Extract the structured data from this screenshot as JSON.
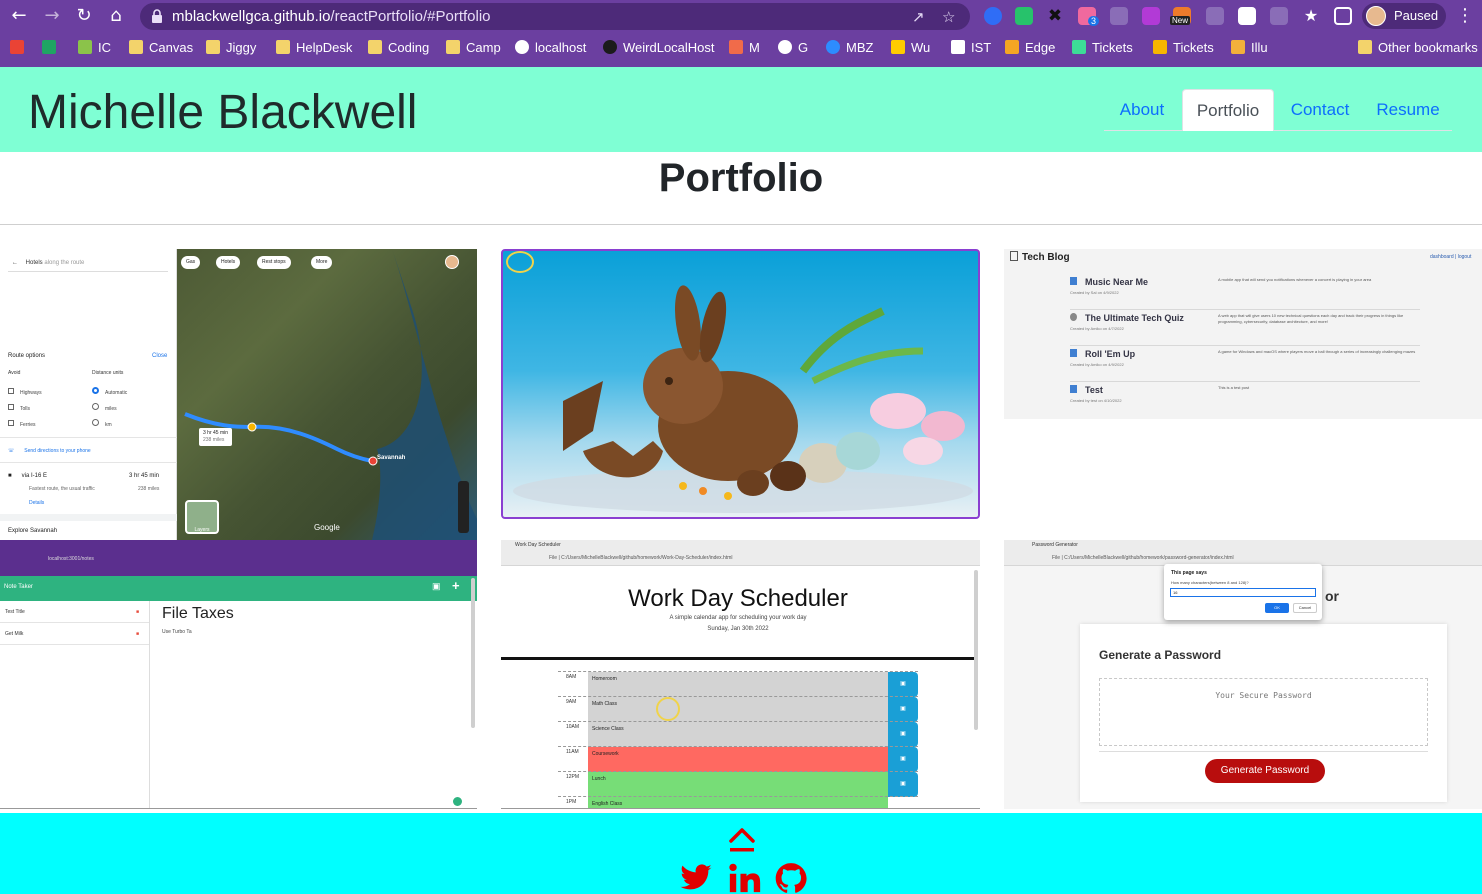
{
  "browser": {
    "url_host": "mblackwellgca.github.io",
    "url_path": "/reactPortfolio/#Portfolio",
    "profile_status": "Paused",
    "extension_badge_count": "3",
    "extension_new_label": "New",
    "bookmarks": [
      {
        "label": "",
        "icon": "gmail-icon"
      },
      {
        "label": "",
        "icon": "drive-icon"
      },
      {
        "label": "IC",
        "icon": "ic-icon"
      },
      {
        "label": "Canvas",
        "icon": "folder-icon"
      },
      {
        "label": "Jiggy",
        "icon": "folder-icon"
      },
      {
        "label": "HelpDesk",
        "icon": "folder-icon"
      },
      {
        "label": "Coding",
        "icon": "folder-icon"
      },
      {
        "label": "Camp",
        "icon": "folder-icon"
      },
      {
        "label": "localhost",
        "icon": "globe-icon"
      },
      {
        "label": "WeirdLocalHost",
        "icon": "react-icon"
      },
      {
        "label": "M",
        "icon": "m-icon"
      },
      {
        "label": "G",
        "icon": "google-icon"
      },
      {
        "label": "MBZ",
        "icon": "zoom-icon"
      },
      {
        "label": "Wu",
        "icon": "wu-icon"
      },
      {
        "label": "IST",
        "icon": "ist-icon"
      },
      {
        "label": "Edge",
        "icon": "edge-icon"
      },
      {
        "label": "Tickets",
        "icon": "tickets-icon"
      },
      {
        "label": "Tickets",
        "icon": "tickets-icon-2"
      },
      {
        "label": "Illu",
        "icon": "illu-icon"
      },
      {
        "label": "Other bookmarks",
        "icon": "folder-icon"
      }
    ]
  },
  "site": {
    "name": "Michelle Blackwell",
    "nav": [
      "About",
      "Portfolio",
      "Contact",
      "Resume"
    ],
    "active_nav": "Portfolio",
    "section_title": "Portfolio"
  },
  "tiles": {
    "maps": {
      "search_text": "Hotels",
      "search_hint": "along the route",
      "chips": [
        "Gas",
        "Hotels",
        "Rest stops",
        "More"
      ],
      "route_options": "Route options",
      "close": "Close",
      "avoid": "Avoid",
      "distance_units": "Distance units",
      "avoid_items": [
        "Highways",
        "Tolls",
        "Ferries"
      ],
      "unit_items": [
        "Automatic",
        "miles",
        "km"
      ],
      "send_directions": "Send directions to your phone",
      "via": "via I-16 E",
      "duration": "3 hr 45 min",
      "route_note": "Fastest route, the usual traffic",
      "distance": "238 miles",
      "details": "Details",
      "explore": "Explore Savannah",
      "callout_time": "3 hr 45 min",
      "callout_dist": "238 miles",
      "city": "Savannah",
      "brand": "Google",
      "layers": "Layers"
    },
    "note_taker": {
      "title": "Note Taker",
      "url": "localhost:3001/notes",
      "notes": [
        "Test Title",
        "Get Milk"
      ],
      "open_title": "File Taxes",
      "open_text": "Use Turbo Ta"
    },
    "tech_blog": {
      "title": "Tech Blog",
      "links": "dashboard | logout",
      "posts": [
        {
          "title": "Music Near Me",
          "meta": "Created by Sal on 4/9/2022",
          "desc": "A mobile app that will send you notifications whenever a concert is playing in your area"
        },
        {
          "title": "The Ultimate Tech Quiz",
          "meta": "Created by Amiko on 4/7/2022",
          "desc": "A web app that will give users 10 new technical questions each day and track their progress in things like programming, cybersecurity, database architecture, and more!"
        },
        {
          "title": "Roll 'Em Up",
          "meta": "Created by Amiko on 4/9/2022",
          "desc": "A game for Windows and macOS where players move a ball through a series of increasingly challenging mazes"
        },
        {
          "title": "Test",
          "meta": "Created by test on 4/10/2022",
          "desc": "This is a test post"
        }
      ]
    },
    "scheduler": {
      "tab": "Work Day Scheduler",
      "url": "File | C:/Users/MichelleBlackwell/github/homework/Work-Day-Scheduler/index.html",
      "title": "Work Day Scheduler",
      "subtitle": "A simple calendar app for scheduling your work day",
      "date": "Sunday, Jan 30th 2022",
      "rows": [
        {
          "hour": "8AM",
          "text": "Homeroom",
          "state": "past"
        },
        {
          "hour": "9AM",
          "text": "Math Class",
          "state": "past"
        },
        {
          "hour": "10AM",
          "text": "Science Class",
          "state": "past"
        },
        {
          "hour": "11AM",
          "text": "Coursework",
          "state": "present"
        },
        {
          "hour": "12PM",
          "text": "Lunch",
          "state": "future"
        },
        {
          "hour": "1PM",
          "text": "English Class",
          "state": "future"
        }
      ]
    },
    "password": {
      "tab": "Password Generator",
      "url": "File | C:/Users/MichelleBlackwell/github/homework/password-generator/index.html",
      "dialog_title": "This page says",
      "dialog_prompt": "How many characters(between 8 and 128)?",
      "dialog_value": "16",
      "ok": "OK",
      "cancel": "Cancel",
      "title_tail": "or",
      "card_title": "Generate a Password",
      "placeholder": "Your Secure Password",
      "button": "Generate Password"
    }
  },
  "footer": {
    "links": [
      "twitter-icon",
      "linkedin-icon",
      "github-icon"
    ]
  },
  "colors": {
    "header_bg": "#7fffd4",
    "footer_bg": "#00ffff",
    "chrome_bg": "#6b3fa0",
    "accent_red": "#e00000",
    "link_blue": "#0d6efd"
  }
}
